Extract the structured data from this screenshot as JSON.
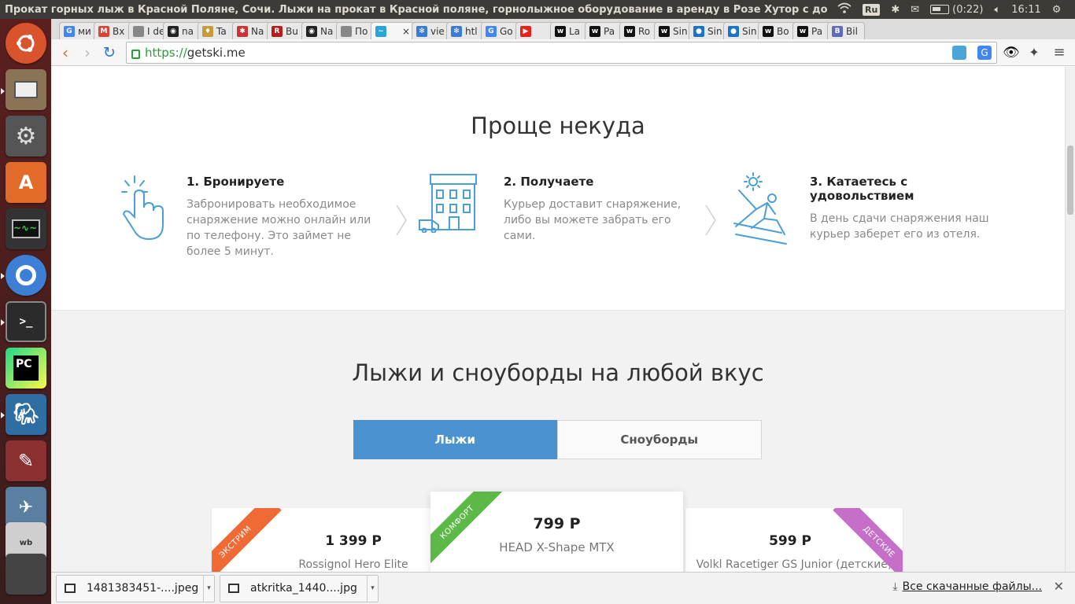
{
  "system_panel": {
    "window_title": "Прокат горных лыж в Красной Поляне, Сочи. Лыжи на прокат в Красной поляне, горнолыжное оборудование в аренду в Розе Хутор с достав",
    "keyboard_layout": "Ru",
    "battery": "(0:22)",
    "clock": "16:11"
  },
  "launcher": {
    "apps": [
      "ubuntu-dash",
      "files",
      "system-settings",
      "software-center",
      "system-monitor",
      "chromium",
      "terminal",
      "pycharm",
      "pgadmin",
      "paint",
      "settings-tweak",
      "mysql-workbench",
      "other"
    ]
  },
  "tabs": [
    {
      "label": "ми",
      "favicon": "google",
      "color": "#4285f4",
      "glyph": "G"
    },
    {
      "label": "Вх",
      "favicon": "gmail",
      "color": "#d44638",
      "glyph": "M"
    },
    {
      "label": "I de",
      "favicon": "doc",
      "color": "#888888",
      "glyph": ""
    },
    {
      "label": "na",
      "favicon": "github",
      "color": "#222222",
      "glyph": "◉"
    },
    {
      "label": "Ta",
      "favicon": "tag",
      "color": "#c79a3a",
      "glyph": "♦"
    },
    {
      "label": "Na",
      "favicon": "python",
      "color": "#cc3333",
      "glyph": "✱"
    },
    {
      "label": "Bu",
      "favicon": "dr",
      "color": "#b71c1c",
      "glyph": "R"
    },
    {
      "label": "Na",
      "favicon": "github",
      "color": "#222222",
      "glyph": "◉"
    },
    {
      "label": "По",
      "favicon": "doc",
      "color": "#888888",
      "glyph": ""
    },
    {
      "label": "",
      "favicon": "getski",
      "color": "#2aa5d6",
      "glyph": "~",
      "active": true
    },
    {
      "label": "vie",
      "favicon": "gear",
      "color": "#3a7bd5",
      "glyph": "✻"
    },
    {
      "label": "htl",
      "favicon": "gear",
      "color": "#3a7bd5",
      "glyph": "✻"
    },
    {
      "label": "Go",
      "favicon": "translate",
      "color": "#4285f4",
      "glyph": "G"
    },
    {
      "label": "",
      "favicon": "youtube",
      "color": "#e62117",
      "glyph": "▶"
    },
    {
      "label": "La",
      "favicon": "w",
      "color": "#111111",
      "glyph": "w"
    },
    {
      "label": "Pa",
      "favicon": "w",
      "color": "#111111",
      "glyph": "w"
    },
    {
      "label": "Ro",
      "favicon": "w",
      "color": "#111111",
      "glyph": "w"
    },
    {
      "label": "Sin",
      "favicon": "w",
      "color": "#111111",
      "glyph": "w"
    },
    {
      "label": "Sin",
      "favicon": "drop",
      "color": "#1a73c8",
      "glyph": "●"
    },
    {
      "label": "Sin",
      "favicon": "drop",
      "color": "#1a73c8",
      "glyph": "●"
    },
    {
      "label": "Bo",
      "favicon": "w",
      "color": "#111111",
      "glyph": "w"
    },
    {
      "label": "Pa",
      "favicon": "w",
      "color": "#111111",
      "glyph": "w"
    },
    {
      "label": "Bil",
      "favicon": "bil",
      "color": "#5c6bc0",
      "glyph": "B"
    }
  ],
  "toolbar": {
    "scheme": "https://",
    "host": "getski.me"
  },
  "section_how": {
    "title": "Проще некуда",
    "steps": [
      {
        "title": "1. Бронируете",
        "text": "Забронировать необходимое снаряжение можно онлайн или по телефону. Это займет не более 5 минут."
      },
      {
        "title": "2. Получаете",
        "text": "Курьер доставит снаряжение, либо вы можете забрать его сами."
      },
      {
        "title": "3. Катаетесь с удовольствием",
        "text": "В день сдачи снаряжения наш курьер заберет его из отеля."
      }
    ]
  },
  "section_catalog": {
    "title": "Лыжи и сноуборды на любой вкус",
    "tabs": [
      {
        "label": "Лыжи",
        "active": true
      },
      {
        "label": "Сноуборды",
        "active": false
      }
    ],
    "cards": [
      {
        "badge": "ЭКСТРИМ",
        "badge_color": "#f06a35",
        "price": "1 399 Р",
        "name": "Rossignol Hero Elite"
      },
      {
        "badge": "КОМФОРТ",
        "badge_color": "#5cb947",
        "price": "799 Р",
        "name": "HEAD X-Shape MTX"
      },
      {
        "badge": "ДЕТСКИЕ",
        "badge_color": "#c56fc9",
        "price": "599 Р",
        "name": "Volkl Racetiger GS Junior (детские)"
      }
    ]
  },
  "downloads": {
    "items": [
      "1481383451-....jpeg",
      "atkritka_1440....jpg"
    ],
    "show_all": "Все скачанные файлы..."
  }
}
